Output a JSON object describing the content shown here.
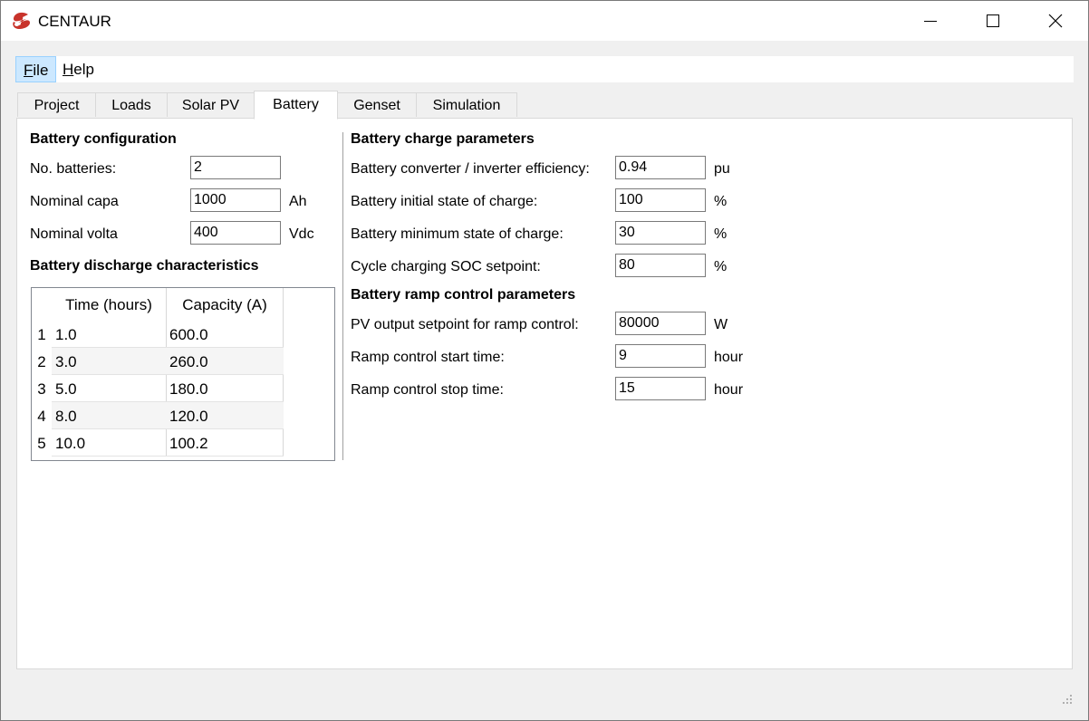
{
  "window": {
    "title": "CENTAUR"
  },
  "menu": {
    "file": "File",
    "help": "Help"
  },
  "tabs": [
    "Project",
    "Loads",
    "Solar PV",
    "Battery",
    "Genset",
    "Simulation"
  ],
  "active_tab": "Battery",
  "battery_config": {
    "heading": "Battery configuration",
    "no_batteries_label": "No. batteries:",
    "no_batteries_value": "2",
    "nominal_capa_label": "Nominal capa",
    "nominal_capa_value": "1000",
    "nominal_capa_unit": "Ah",
    "nominal_volta_label": "Nominal volta",
    "nominal_volta_value": "400",
    "nominal_volta_unit": "Vdc"
  },
  "discharge": {
    "heading": "Battery discharge characteristics",
    "columns": [
      "Time (hours)",
      "Capacity (A)"
    ],
    "rows": [
      {
        "num": "1",
        "time": "1.0",
        "capacity": "600.0"
      },
      {
        "num": "2",
        "time": "3.0",
        "capacity": "260.0"
      },
      {
        "num": "3",
        "time": "5.0",
        "capacity": "180.0"
      },
      {
        "num": "4",
        "time": "8.0",
        "capacity": "120.0"
      },
      {
        "num": "5",
        "time": "10.0",
        "capacity": "100.2"
      }
    ]
  },
  "charge": {
    "heading": "Battery charge parameters",
    "params": [
      {
        "label": "Battery converter / inverter efficiency:",
        "value": "0.94",
        "unit": "pu"
      },
      {
        "label": "Battery initial state of charge:",
        "value": "100",
        "unit": "%"
      },
      {
        "label": "Battery minimum state of charge:",
        "value": "30",
        "unit": "%"
      },
      {
        "label": "Cycle charging SOC setpoint:",
        "value": "80",
        "unit": "%"
      }
    ]
  },
  "ramp": {
    "heading": "Battery ramp control parameters",
    "params": [
      {
        "label": "PV output setpoint for ramp control:",
        "value": "80000",
        "unit": "W"
      },
      {
        "label": "Ramp control start time:",
        "value": "9",
        "unit": "hour"
      },
      {
        "label": "Ramp control stop time:",
        "value": "15",
        "unit": "hour"
      }
    ]
  },
  "colors": {
    "logo": "#c8332b",
    "selected_menu": "#cce8ff"
  }
}
